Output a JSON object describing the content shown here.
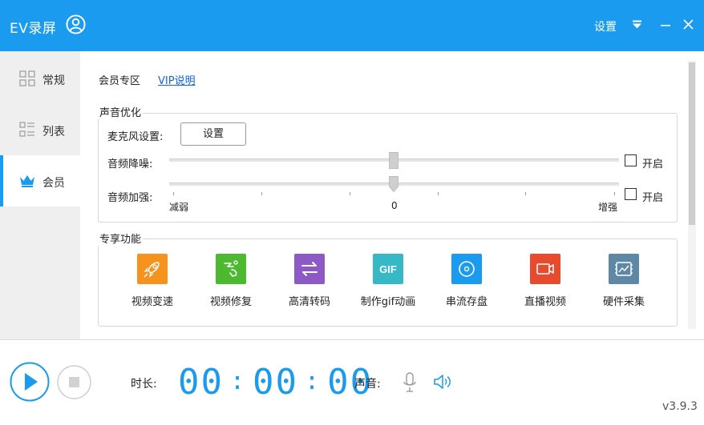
{
  "titlebar": {
    "app_title": "EV录屏",
    "settings_label": "设置"
  },
  "sidebar": {
    "items": [
      {
        "label": "常规",
        "icon": "grid-icon"
      },
      {
        "label": "列表",
        "icon": "list-icon"
      },
      {
        "label": "会员",
        "icon": "crown-icon"
      }
    ],
    "active_index": 2
  },
  "vip": {
    "section_title": "会员专区",
    "link_label": "VIP说明"
  },
  "sound_opt": {
    "group_title": "声音优化",
    "mic_label": "麦克风设置:",
    "mic_button": "设置",
    "noise_label": "音频降噪:",
    "noise_enabled": false,
    "noise_value": 0.5,
    "boost_label": "音频加强:",
    "boost_enabled": false,
    "boost_value": 0,
    "enable_label": "开启",
    "scale_min": "减弱",
    "scale_mid": "0",
    "scale_max": "增强"
  },
  "features": {
    "group_title": "专享功能",
    "items": [
      {
        "label": "视频变速",
        "icon": "rocket-icon",
        "color": "#f6921e"
      },
      {
        "label": "视频修复",
        "icon": "repair-icon",
        "color": "#4cb931"
      },
      {
        "label": "高清转码",
        "icon": "transcode-icon",
        "color": "#8d59c6"
      },
      {
        "label": "制作gif动画",
        "icon": "gif-icon",
        "color": "#36b8c7",
        "icon_text": "GIF"
      },
      {
        "label": "串流存盘",
        "icon": "disc-icon",
        "color": "#1a9bf0"
      },
      {
        "label": "直播视频",
        "icon": "live-video-icon",
        "color": "#e74a2c"
      },
      {
        "label": "硬件采集",
        "icon": "capture-card-icon",
        "color": "#5f87a6"
      }
    ]
  },
  "bottom": {
    "duration_label": "时长:",
    "timer": "00:00:00",
    "sound_label": "声音:",
    "version": "v3.9.3"
  },
  "colors": {
    "accent": "#1a9bf0"
  }
}
